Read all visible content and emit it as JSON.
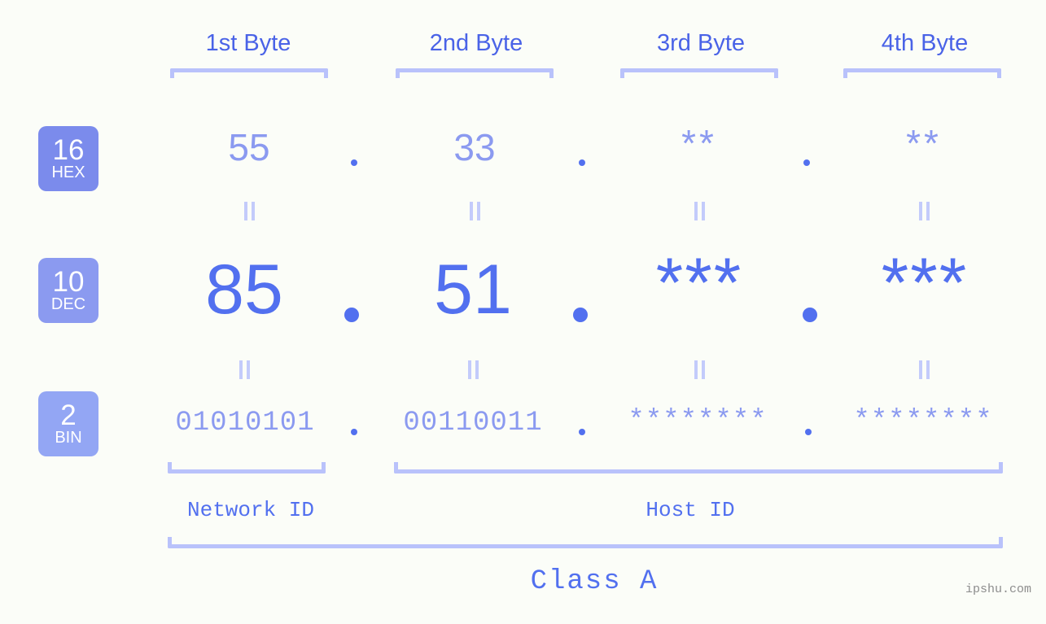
{
  "canvas": {
    "background": "#fbfdf8",
    "accent": "#5270ef",
    "accent_light": "#8b9af0",
    "bracket": "#b9c2fb",
    "eq_color": "#c3cbfb"
  },
  "byte_headers": [
    {
      "label": "1st Byte"
    },
    {
      "label": "2nd Byte"
    },
    {
      "label": "3rd Byte"
    },
    {
      "label": "4th Byte"
    }
  ],
  "bases": [
    {
      "number": "16",
      "name": "HEX",
      "color": "#7b8bec"
    },
    {
      "number": "10",
      "name": "DEC",
      "color": "#8b9af0"
    },
    {
      "number": "2",
      "name": "BIN",
      "color": "#93a6f4"
    }
  ],
  "rows": {
    "hex": {
      "values": [
        "55",
        "33",
        "**",
        "**"
      ],
      "separator": "."
    },
    "dec": {
      "values": [
        "85",
        "51",
        "***",
        "***"
      ],
      "separator": "."
    },
    "bin": {
      "values": [
        "01010101",
        "00110011",
        "********",
        "********"
      ],
      "separator": "."
    }
  },
  "equality_symbol": "||",
  "segments": {
    "network_id": "Network ID",
    "host_id": "Host ID",
    "class": "Class A"
  },
  "watermark": "ipshu.com"
}
